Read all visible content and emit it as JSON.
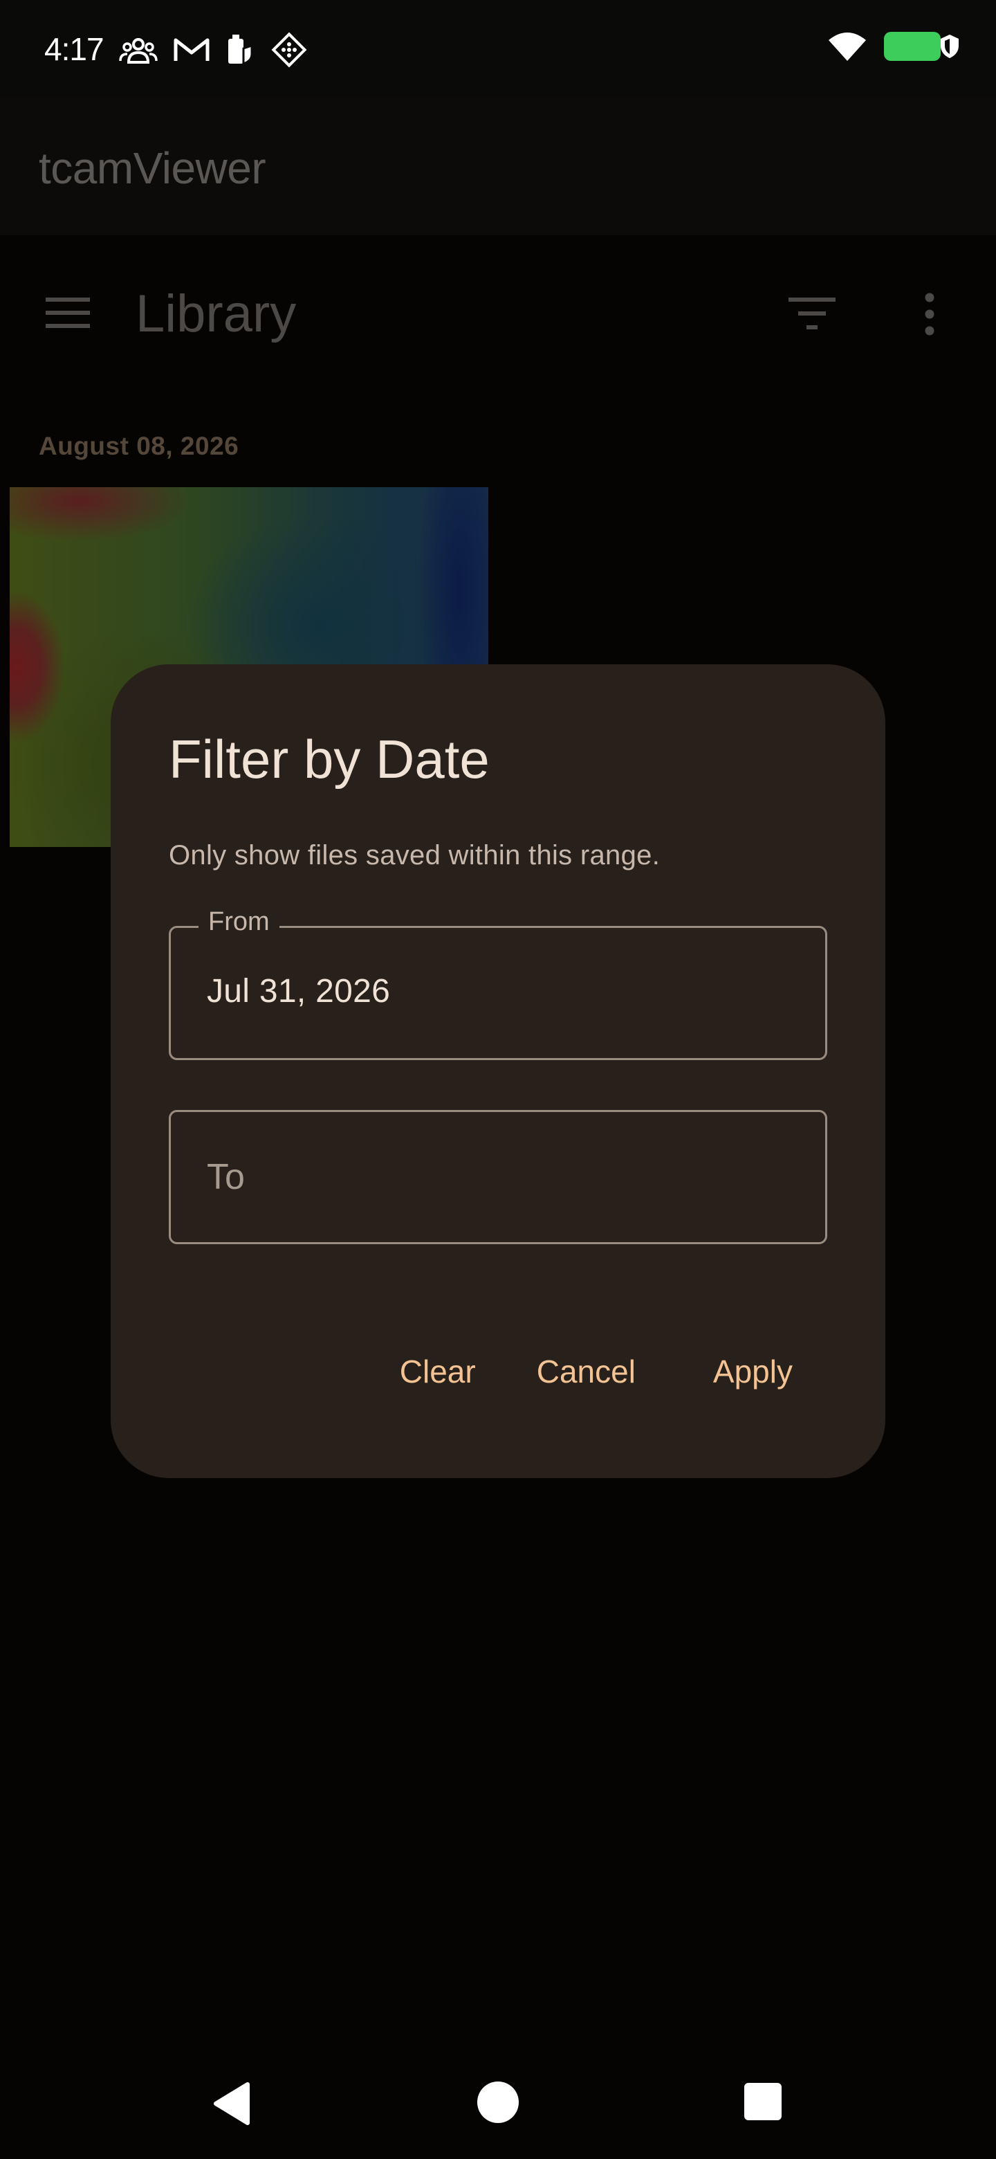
{
  "status_bar": {
    "time": "4:17",
    "left_icons": [
      "people-icon",
      "gmail-icon",
      "battery-saver-icon",
      "app-icon"
    ],
    "right_icons": [
      "wifi-icon",
      "battery-icon",
      "shield-icon"
    ],
    "battery_color": "#3ccd5a"
  },
  "app_bar": {
    "title": "tcamViewer"
  },
  "toolbar": {
    "title": "Library",
    "icons": [
      "menu-icon",
      "filter-icon",
      "more-vert-icon"
    ]
  },
  "library": {
    "date_header": "August 08, 2026"
  },
  "dialog": {
    "title": "Filter by Date",
    "subtitle": "Only show files saved within this range.",
    "from_label": "From",
    "from_value": "Jul 31, 2026",
    "to_placeholder": "To",
    "clear_label": "Clear",
    "cancel_label": "Cancel",
    "apply_label": "Apply",
    "accent_color": "#f3c394"
  },
  "nav_bar": {
    "icons": [
      "back-icon",
      "home-icon",
      "recents-icon"
    ]
  }
}
